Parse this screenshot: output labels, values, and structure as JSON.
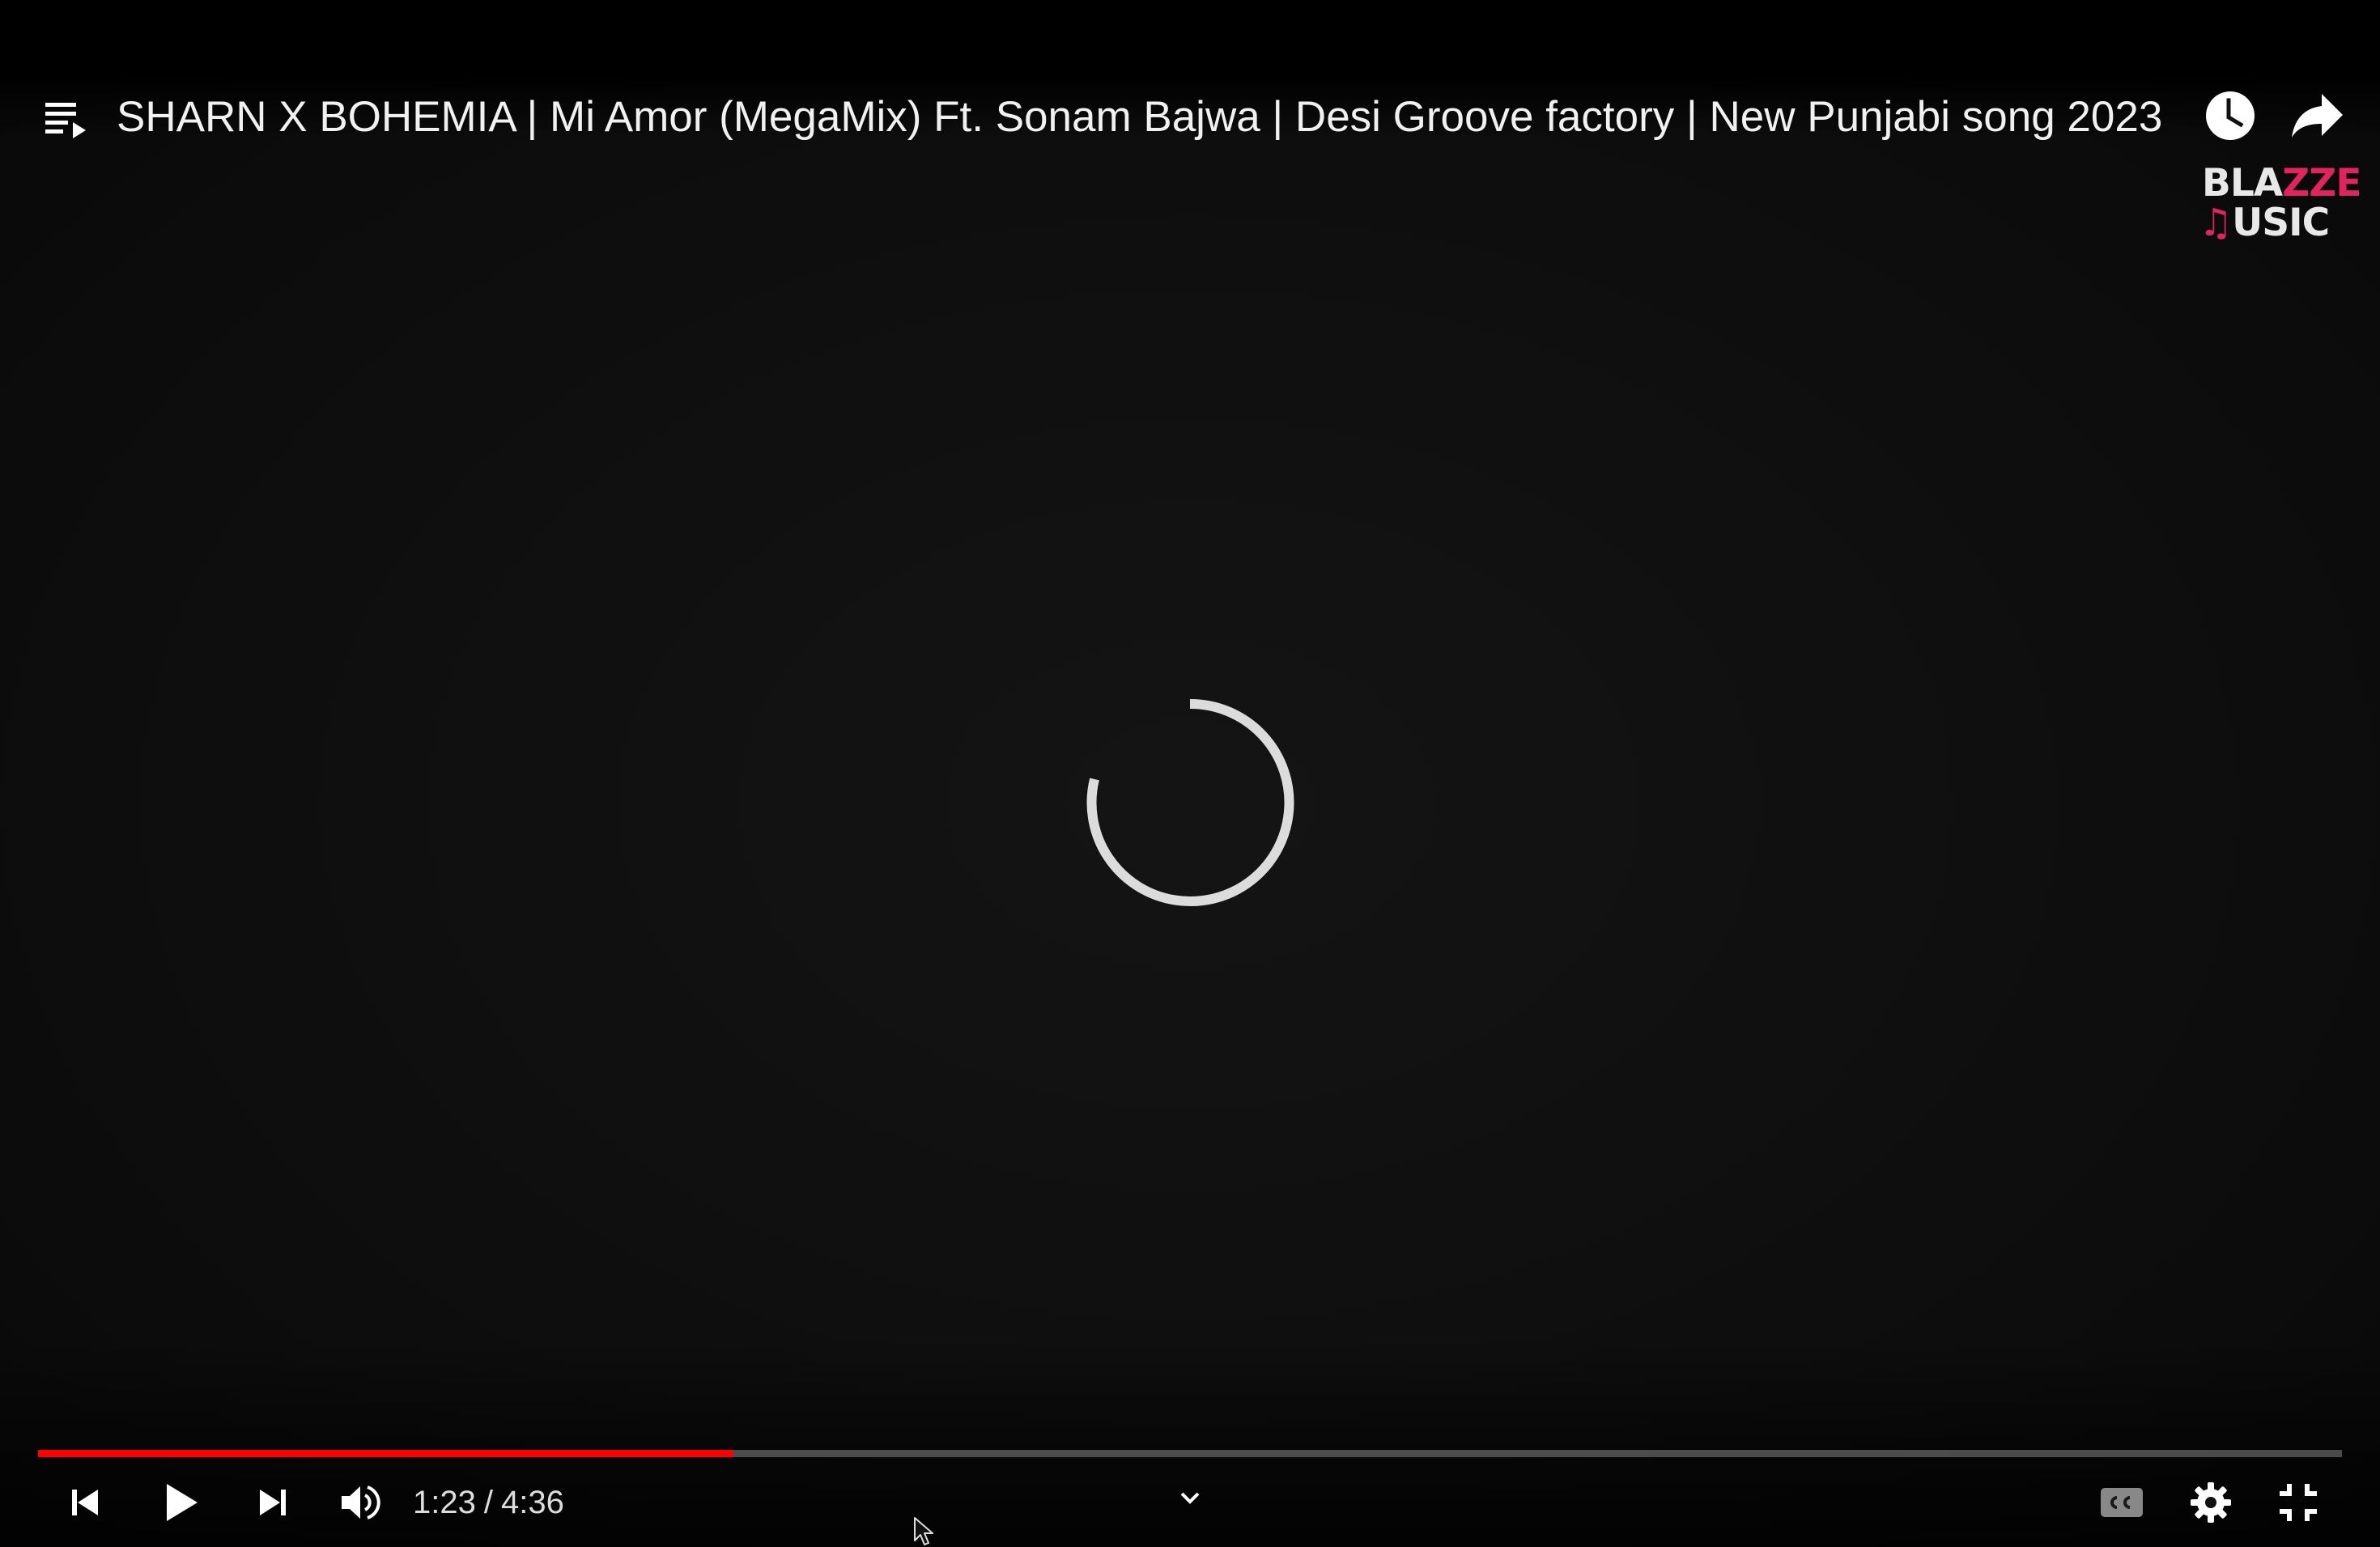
{
  "video": {
    "title": "SHARN X BOHEMIA | Mi Amor (MegaMix) Ft. Sonam Bajwa | Desi Groove factory | New Punjabi song 2023",
    "state": "buffering"
  },
  "top_bar": {
    "playlist_icon": "playlist-icon",
    "watch_later_icon": "clock-icon",
    "share_icon": "share-arrow-icon"
  },
  "watermark": {
    "line1_a": "BLA",
    "line1_b": "ZZE",
    "line2_note": "♫",
    "line2_text": "USIC"
  },
  "progress": {
    "played_fraction": 0.302,
    "buffered_fraction": 0.302,
    "played_color": "#ff0000"
  },
  "controls": {
    "current_time": "1:23",
    "separator": "/",
    "duration": "4:36",
    "icons": {
      "previous": "skip-previous-icon",
      "play": "play-icon",
      "next": "skip-next-icon",
      "volume": "volume-icon",
      "chapters": "chevron-down-icon",
      "captions": "cc-icon",
      "settings": "gear-icon",
      "fullscreen_exit": "exit-fullscreen-icon"
    }
  }
}
